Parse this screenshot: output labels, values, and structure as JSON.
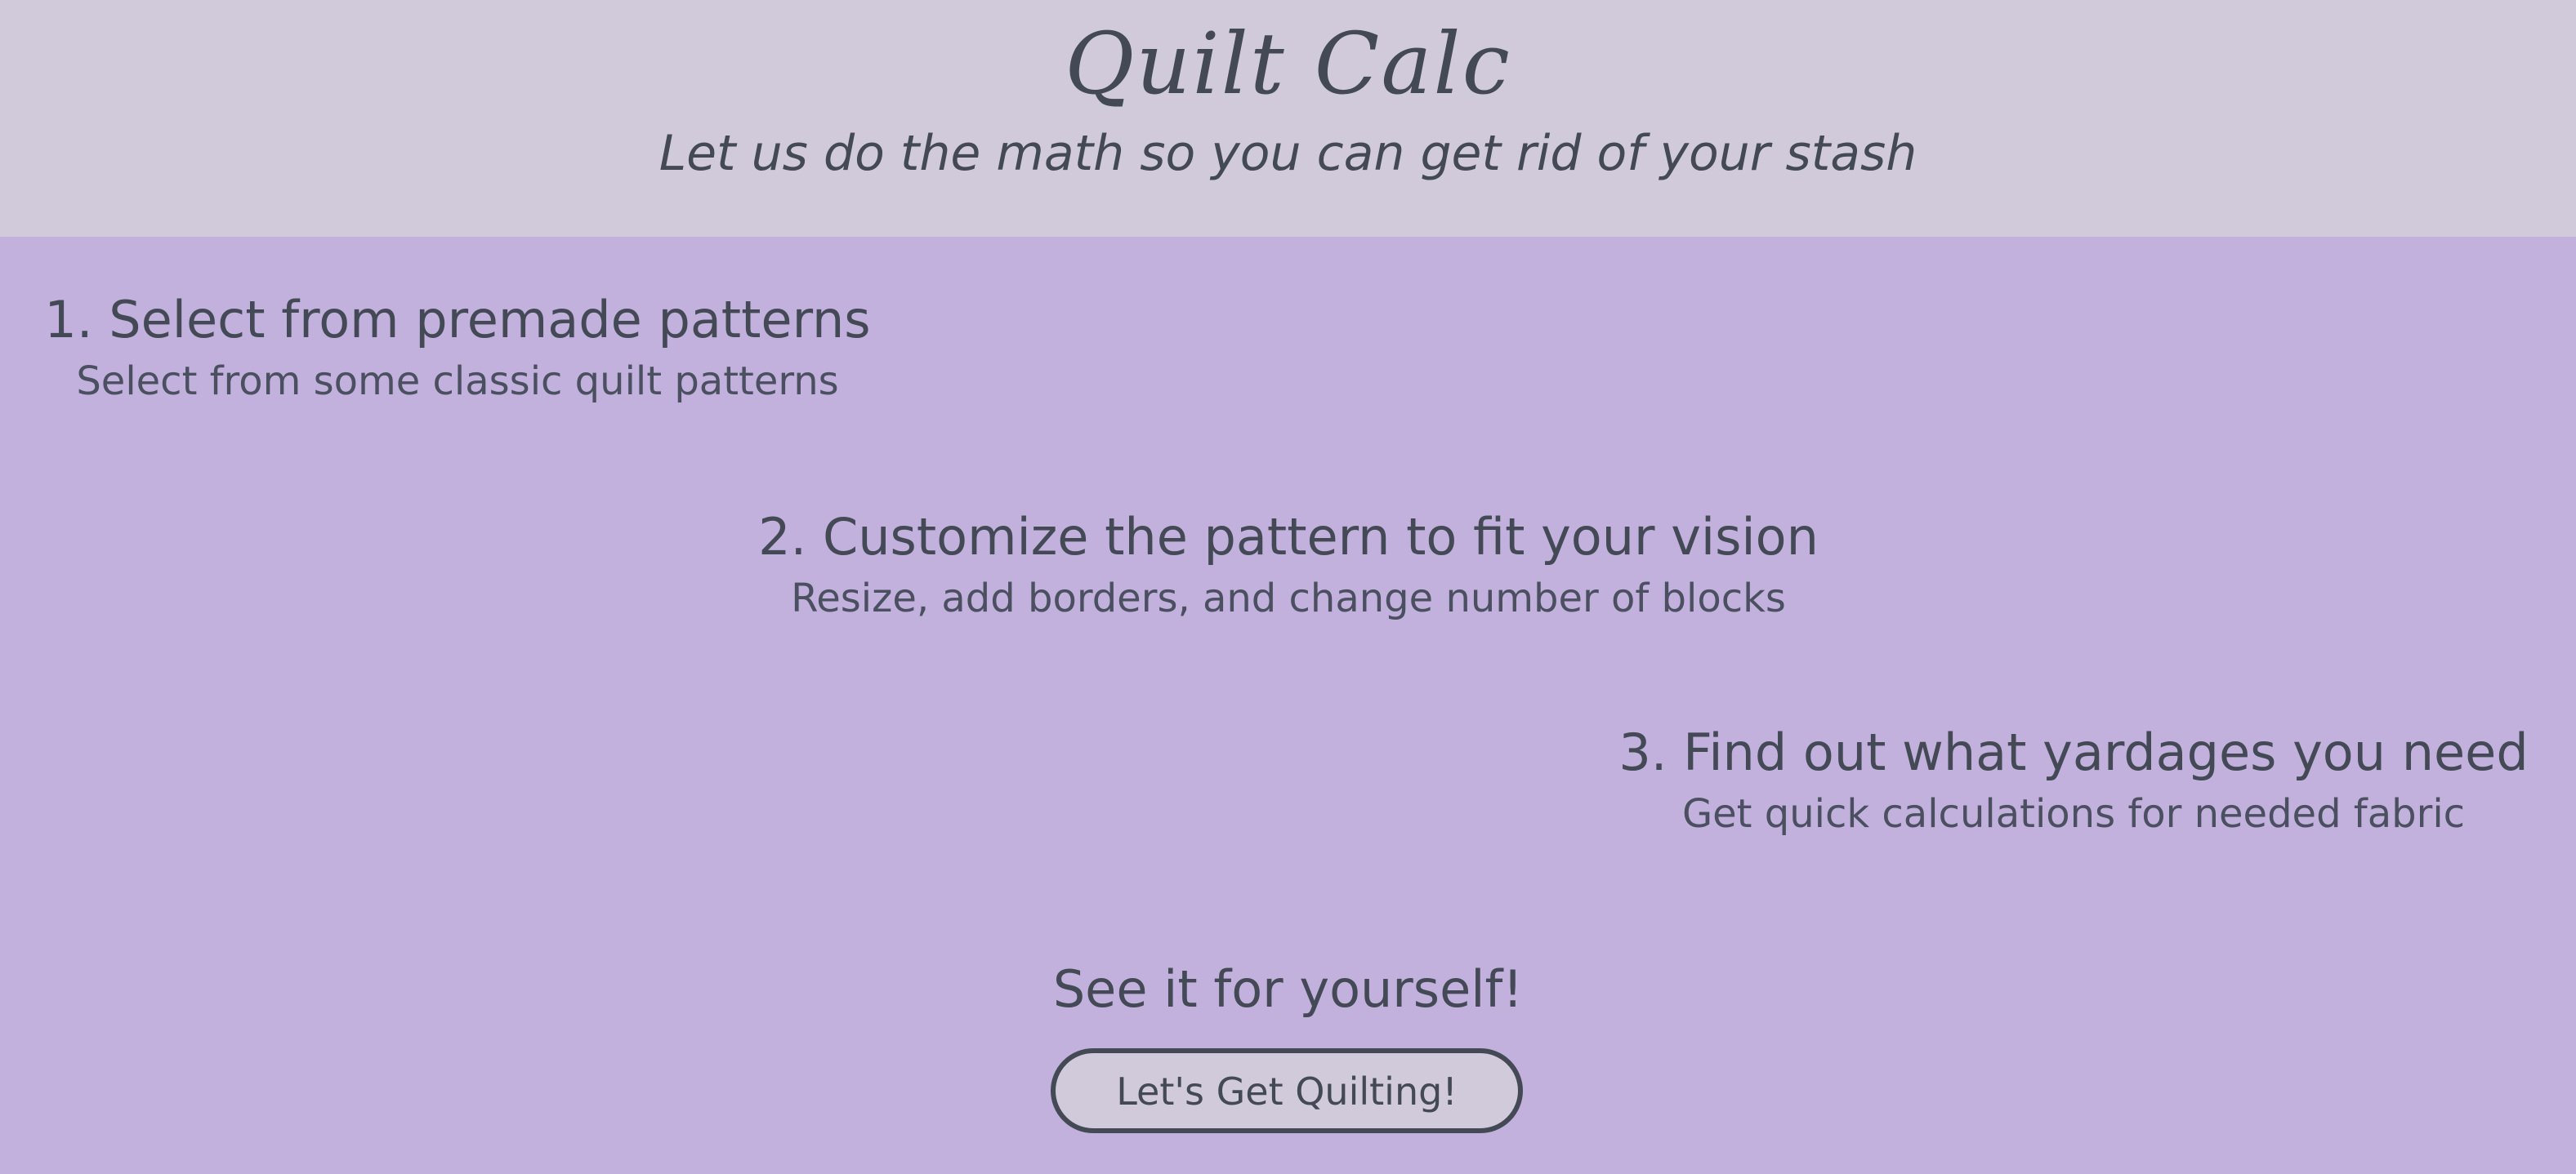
{
  "header": {
    "title": "Quilt Calc",
    "tagline": "Let us do the math so you can get rid of your stash",
    "background_color": "#d0cadb"
  },
  "steps": [
    {
      "heading": "1. Select from premade patterns",
      "description": "Select from some classic quilt patterns"
    },
    {
      "heading": "2. Customize the pattern to fit your vision",
      "description": "Resize, add borders, and change number of blocks"
    },
    {
      "heading": "3. Find out what yardages you need",
      "description": "Get quick calculations for needed fabric"
    }
  ],
  "cta": {
    "heading": "See it for yourself!",
    "button_label": "Let's Get Quilting!"
  },
  "colors": {
    "page_background": "#c2b0dd",
    "text": "#434955",
    "button_background": "#d0cadb",
    "button_border": "#434955"
  }
}
